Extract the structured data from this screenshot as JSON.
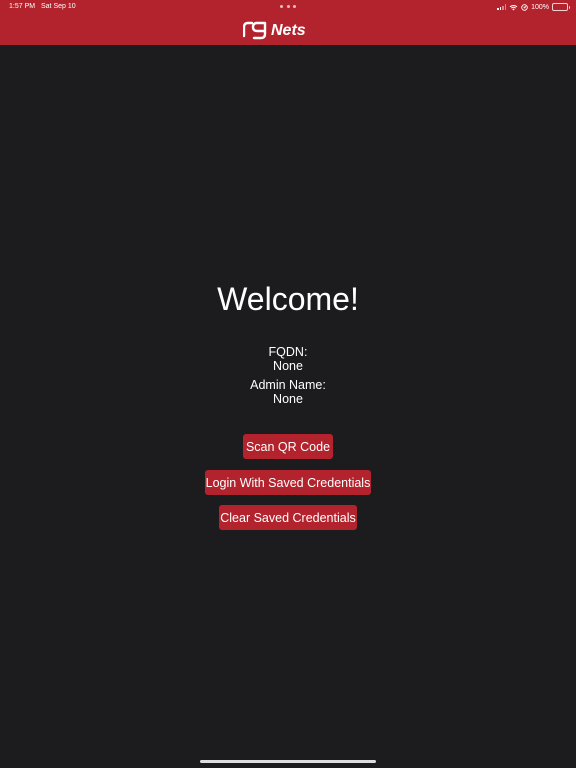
{
  "status_bar": {
    "time": "1:57 PM",
    "date": "Sat Sep 10",
    "battery_percent": "100%",
    "battery_level": 1.0,
    "battery_charging": true
  },
  "header": {
    "logo_text": "rgNets",
    "background_color": "#b3232d"
  },
  "main": {
    "welcome_title": "Welcome!",
    "fqdn_label": "FQDN:",
    "fqdn_value": "None",
    "admin_label": "Admin Name:",
    "admin_value": "None",
    "buttons": {
      "scan_qr": "Scan QR Code",
      "login_saved": "Login With Saved Credentials",
      "clear_saved": "Clear Saved Credentials"
    },
    "button_color": "#b3232d",
    "background_color": "#1c1c1e"
  },
  "icons": [
    "signal-icon",
    "wifi-icon",
    "location-icon",
    "battery-icon"
  ]
}
